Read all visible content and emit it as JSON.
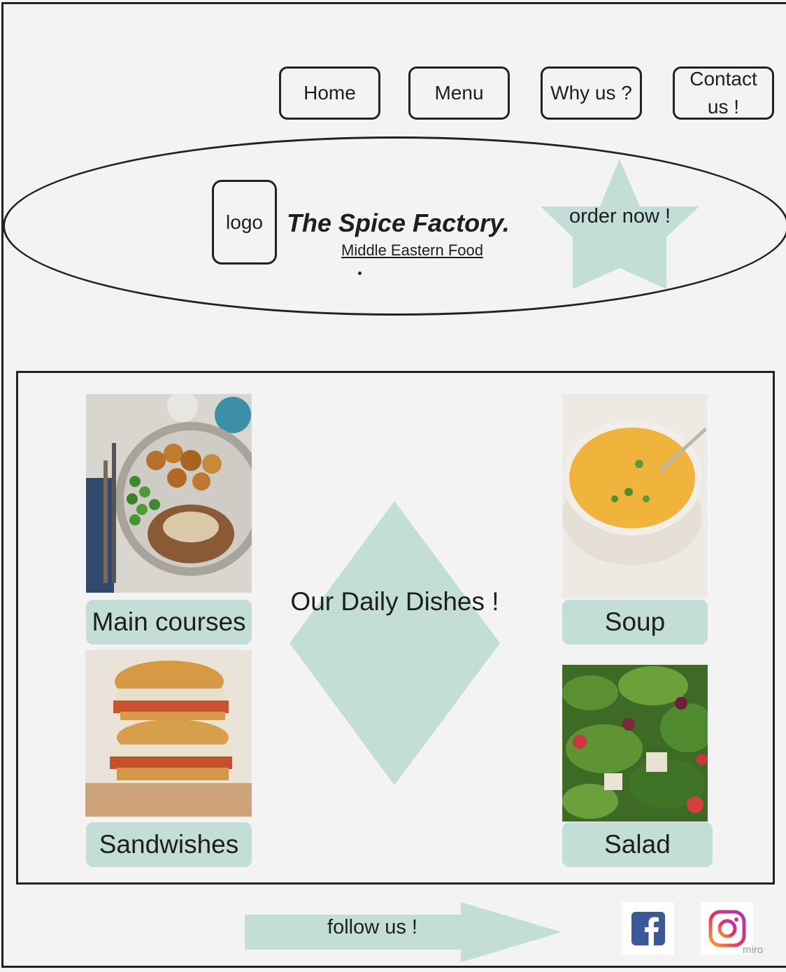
{
  "nav": {
    "home": "Home",
    "menu": "Menu",
    "why": "Why us ?",
    "contact": "Contact us !"
  },
  "header": {
    "logo": "logo",
    "title": "The Spice Factory.",
    "subtitle": "Middle Eastern Food",
    "cta": "order now !"
  },
  "dishes": {
    "center_title": "Our Daily Dishes !",
    "items": [
      {
        "label": "Main courses",
        "image": "main-course-photo"
      },
      {
        "label": "Sandwishes",
        "image": "sandwich-photo"
      },
      {
        "label": "Soup",
        "image": "soup-photo"
      },
      {
        "label": "Salad",
        "image": "salad-photo"
      }
    ]
  },
  "footer": {
    "follow": "follow us !",
    "social": [
      "facebook-icon",
      "instagram-icon"
    ],
    "watermark": "miro"
  },
  "colors": {
    "accent": "#c3ded7",
    "outline": "#222222",
    "background": "#f3f3f3",
    "facebook": "#3b5998"
  }
}
